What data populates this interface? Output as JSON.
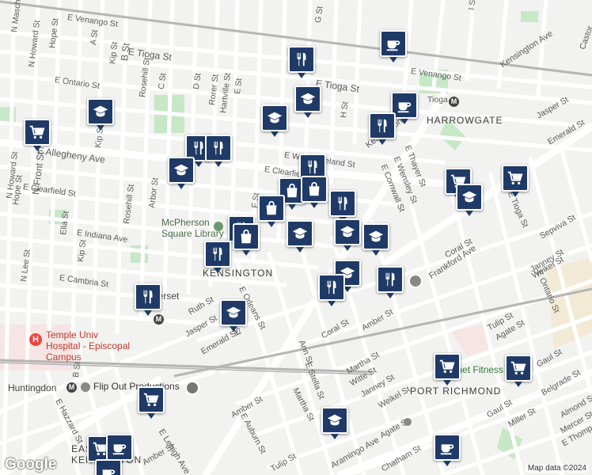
{
  "streets": {
    "venango": "E Venango St",
    "venango2": "E Venango St",
    "tioga1": "E Tioga St",
    "tioga2": "E Tioga St",
    "tioga3": "Tioga",
    "ontario": "E Ontario St",
    "allegheny": "E Allegheny Ave",
    "westmoreland": "E Westmoreland St",
    "clearfield": "E Clearfield St",
    "indiana": "E Indiana Ave",
    "cambria": "E Cambria St",
    "somerset": "Somerset",
    "kensington_ave": "Kensington Ave",
    "kensington_ave2": "Kensington Ave",
    "frankford": "Frankford Ave",
    "jasper": "Jasper St",
    "jasper2": "Jasper St",
    "coral": "Coral St",
    "coral2": "Coral St",
    "amber": "Amber St",
    "amber2": "Amber St",
    "emerald": "Emerald St",
    "emerald2": "Emerald St",
    "ruth": "Ruth St",
    "orleans": "E Orleans St",
    "birch": "Birch St",
    "martha": "Martha St",
    "martha2": "Martha St",
    "witte": "Witte St",
    "janney": "Janney St",
    "janney2": "Janney St",
    "weikel": "Weikel St",
    "weikel2": "Weikel St",
    "agate": "Agate St",
    "agate2": "Agate St",
    "tulip": "Tulip St",
    "tulip2": "Tulip St",
    "gaul": "Gaul St",
    "gaul2": "Gaul St",
    "belgrade": "Belgrade St",
    "almond": "Almond St",
    "miller": "Miller St",
    "mercer": "Mercer St",
    "thompson": "E Thomp",
    "aramingo": "Aramingo Ave",
    "lehigh": "E Lehigh Ave",
    "chatham": "Chatham St",
    "auburn": "E Auburn St",
    "hazzard": "E Hazzard St",
    "amber3": "Amber St",
    "stella": "E Stella St",
    "ann": "Ann St",
    "sepviva": "Sepviva St",
    "tioga_e": "E Tioga St",
    "ontario_e": "E Ontario St",
    "thayer": "E Thayer St",
    "wensley": "E Wensley St",
    "cornwall": "E Cornwall St",
    "mascher": "N Mascher St",
    "howard": "N Howard St",
    "hope": "Hope St",
    "front": "N Front St",
    "lee": "N Lee St",
    "kip": "Kip St",
    "rosehill": "Rosehill St",
    "arbor": "Arbor St",
    "ella": "Ella St",
    "a_st": "A St",
    "b_st": "B St",
    "c_st": "C St",
    "d_st": "D St",
    "e_st": "E St",
    "f_st": "F St",
    "g_st": "G St",
    "h_st": "H St",
    "i_st": "I St",
    "rorer": "Rorer St",
    "hartville": "Hartville St",
    "castor": "Castor",
    "clearfield_diag": "E Clearfield",
    "emerald_v": "Emerald St"
  },
  "places": {
    "library": "McPherson Square Library",
    "kensington": "KENSINGTON",
    "harrowgate": "HARROWGATE",
    "port_richmond": "PORT RICHMOND",
    "east_kensington": "EAST KENSINGTON",
    "hospital": "Temple Univ Hospital - Episcopal Campus",
    "huntingdon": "Huntingdon",
    "flipout": "Flip Out Productions",
    "planet_fitness": "Planet Fitness",
    "station_symbol": "M"
  },
  "footer": {
    "logo": "Google",
    "attribution": "Map data ©2024"
  },
  "markers": [
    {
      "type": "cafe",
      "label": "cafe-icon"
    },
    {
      "type": "restaurant",
      "label": "restaurant-icon"
    },
    {
      "type": "school",
      "label": "school-icon"
    },
    {
      "type": "grocery",
      "label": "grocery-cart-icon"
    },
    {
      "type": "shopping",
      "label": "shopping-bag-icon"
    }
  ],
  "colors": {
    "marker": "#1f3a66",
    "park": "#c6e8c6",
    "road": "#ffffff",
    "block": "#f2f2f0",
    "railway": "#b5b5b5",
    "hospital": "#e34a3c"
  }
}
